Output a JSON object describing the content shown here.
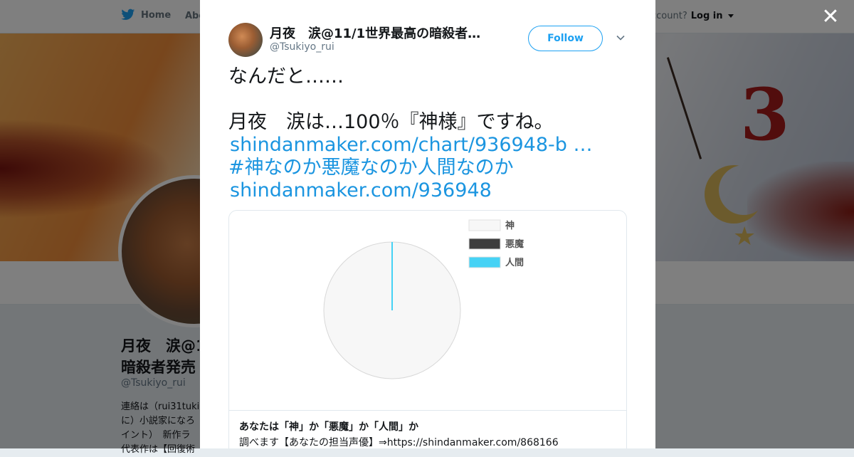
{
  "nav": {
    "home_label": "Home",
    "about_label": "Abo",
    "account_text": "ccount?",
    "login_label": "Log in"
  },
  "profile": {
    "name_line1": "月夜　涙@11",
    "name_line2": "暗殺者発売",
    "handle": "@Tsukiyo_rui",
    "bio_lines": [
      "連絡は（rui31tuki",
      "に）小説家になろ",
      "イント）　新作ラ",
      "代表作は【回復術"
    ]
  },
  "tweet": {
    "author_name": "月夜　涙@11/1世界最高の暗殺者発…",
    "author_handle": "@Tsukiyo_rui",
    "follow_label": "Follow",
    "line1": "なんだと……",
    "line2": "月夜　涙は…100％『神様』ですね。",
    "link1": "shindanmaker.com/chart/936948-b …",
    "hashtag": "#神なのか悪魔なのか人間なのか",
    "link2": "shindanmaker.com/936948"
  },
  "card": {
    "title": "あなたは「神」か「悪魔」か「人間」か",
    "description": "調べます【あなたの担当声優】⇒https://shindanmaker.com/868166"
  },
  "chart_data": {
    "type": "pie",
    "categories": [
      "神",
      "悪魔",
      "人間"
    ],
    "values": [
      100,
      0,
      0
    ],
    "colors": [
      "#f7f7f7",
      "#3d3d3d",
      "#46d2f5"
    ],
    "legend_position": "top-right"
  },
  "colors": {
    "accent": "#1da1f2",
    "link": "#1b95e0"
  }
}
